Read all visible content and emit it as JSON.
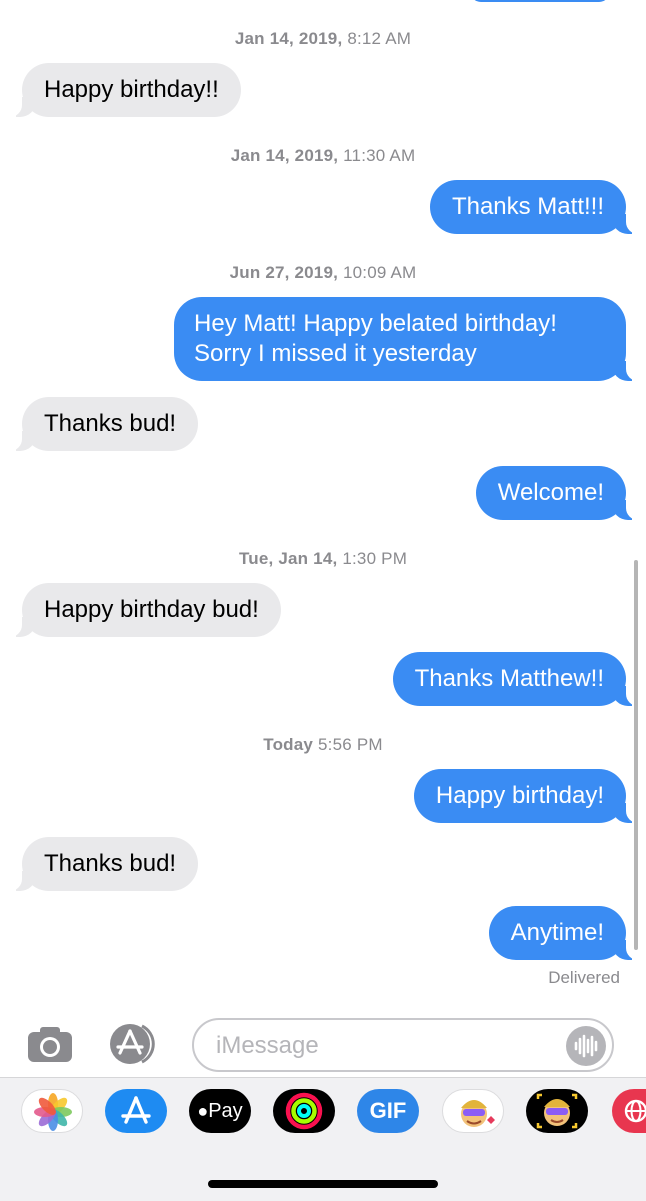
{
  "conversation": {
    "timestamps": [
      {
        "date": "Jan 14, 2019,",
        "time": "8:12 AM"
      },
      {
        "date": "Jan 14, 2019,",
        "time": "11:30 AM"
      },
      {
        "date": "Jun 27, 2019,",
        "time": "10:09 AM"
      },
      {
        "date": "Tue, Jan 14,",
        "time": "1:30 PM"
      },
      {
        "date": "Today",
        "time": "5:56 PM"
      }
    ],
    "messages": [
      {
        "direction": "incoming",
        "text": "Happy birthday!!"
      },
      {
        "direction": "outgoing",
        "text": "Thanks Matt!!!"
      },
      {
        "direction": "outgoing",
        "text": "Hey Matt! Happy belated birthday! Sorry I missed it yesterday"
      },
      {
        "direction": "incoming",
        "text": "Thanks bud!"
      },
      {
        "direction": "outgoing",
        "text": "Welcome!"
      },
      {
        "direction": "incoming",
        "text": "Happy birthday bud!"
      },
      {
        "direction": "outgoing",
        "text": "Thanks Matthew!!"
      },
      {
        "direction": "outgoing",
        "text": "Happy birthday!"
      },
      {
        "direction": "incoming",
        "text": "Thanks bud!"
      },
      {
        "direction": "outgoing",
        "text": "Anytime!"
      }
    ],
    "delivery_status": "Delivered"
  },
  "input_bar": {
    "placeholder": "iMessage",
    "camera_icon": "camera-icon",
    "apps_icon": "app-store-icon",
    "audio_icon": "audio-waveform-icon"
  },
  "app_drawer": {
    "apps": [
      {
        "name": "photos-app-icon"
      },
      {
        "name": "app-store-app-icon"
      },
      {
        "name": "apple-pay-app-icon",
        "label": "Pay"
      },
      {
        "name": "activity-app-icon"
      },
      {
        "name": "gif-app-icon",
        "label": "GIF"
      },
      {
        "name": "memoji-stickers-app-icon"
      },
      {
        "name": "memoji-app-icon"
      },
      {
        "name": "web-search-app-icon"
      }
    ]
  },
  "colors": {
    "outgoing_bubble": "#3a8cf3",
    "incoming_bubble": "#e9e9eb",
    "timestamp_text": "#8a8a8e"
  }
}
